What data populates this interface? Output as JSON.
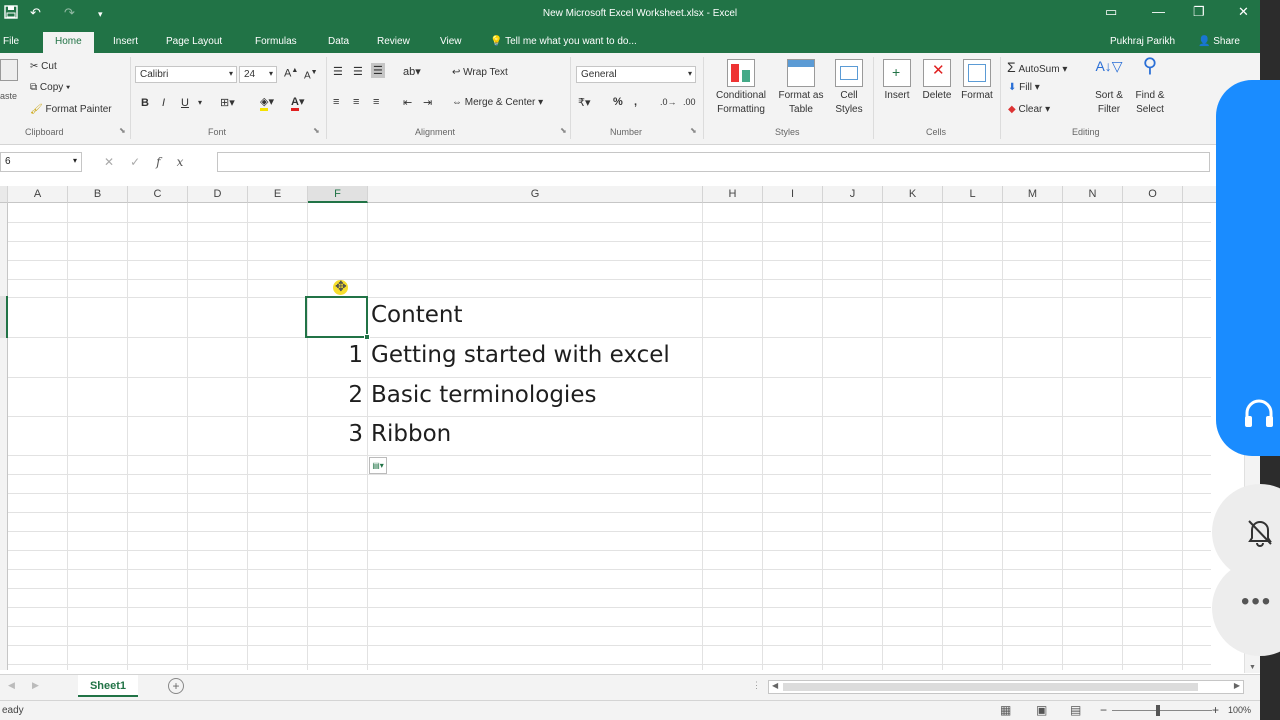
{
  "window": {
    "title": "New Microsoft Excel Worksheet.xlsx - Excel",
    "minimize_glyph": "—",
    "maximize_glyph": "❐",
    "close_glyph": "✕"
  },
  "tabs": [
    "File",
    "Home",
    "Insert",
    "Page Layout",
    "Formulas",
    "Data",
    "Review",
    "View"
  ],
  "active_tab": "Home",
  "tell_me": "Tell me what you want to do...",
  "user_name": "Pukhraj Parikh",
  "share_label": "Share",
  "ribbon": {
    "clipboard": {
      "paste": "aste",
      "cut": "Cut",
      "copy": "Copy",
      "format_painter": "Format Painter",
      "label": "Clipboard"
    },
    "font": {
      "name": "Calibri",
      "size": "24",
      "bold": "B",
      "italic": "I",
      "underline": "U",
      "label": "Font"
    },
    "alignment": {
      "wrap_text": "Wrap Text",
      "merge_center": "Merge & Center",
      "label": "Alignment"
    },
    "number": {
      "format": "General",
      "percent": "%",
      "comma": ",",
      "label": "Number"
    },
    "styles": {
      "conditional_1": "Conditional",
      "conditional_2": "Formatting",
      "format_as_1": "Format as",
      "format_as_2": "Table",
      "cell_1": "Cell",
      "cell_2": "Styles",
      "label": "Styles"
    },
    "cells": {
      "insert": "Insert",
      "delete": "Delete",
      "format": "Format",
      "label": "Cells"
    },
    "editing": {
      "autosum": "AutoSum",
      "fill": "Fill",
      "clear": "Clear",
      "sort_1": "Sort &",
      "sort_2": "Filter",
      "find_1": "Find &",
      "find_2": "Select",
      "label": "Editing"
    }
  },
  "formula_bar": {
    "name_box": "6",
    "fx": "fx",
    "value": ""
  },
  "columns": [
    "A",
    "B",
    "C",
    "D",
    "E",
    "F",
    "G",
    "H",
    "I",
    "J",
    "K",
    "L",
    "M",
    "N",
    "O"
  ],
  "selected_column": "F",
  "cells": {
    "heading": "Content",
    "rows": [
      {
        "num": "1",
        "text": "Getting started with excel"
      },
      {
        "num": "2",
        "text": "Basic terminologies"
      },
      {
        "num": "3",
        "text": "Ribbon"
      }
    ]
  },
  "sheet_tabs": [
    "Sheet1"
  ],
  "status": {
    "ready": "eady",
    "zoom": "100%"
  },
  "icons": [
    "save-icon",
    "undo-icon",
    "redo-icon",
    "lightbulb-icon",
    "person-icon",
    "headphones-icon",
    "bell-off-icon",
    "more-icon",
    "add-sheet-icon"
  ],
  "colors": {
    "excel_green": "#217346",
    "overlay_blue": "#1a8cff"
  }
}
